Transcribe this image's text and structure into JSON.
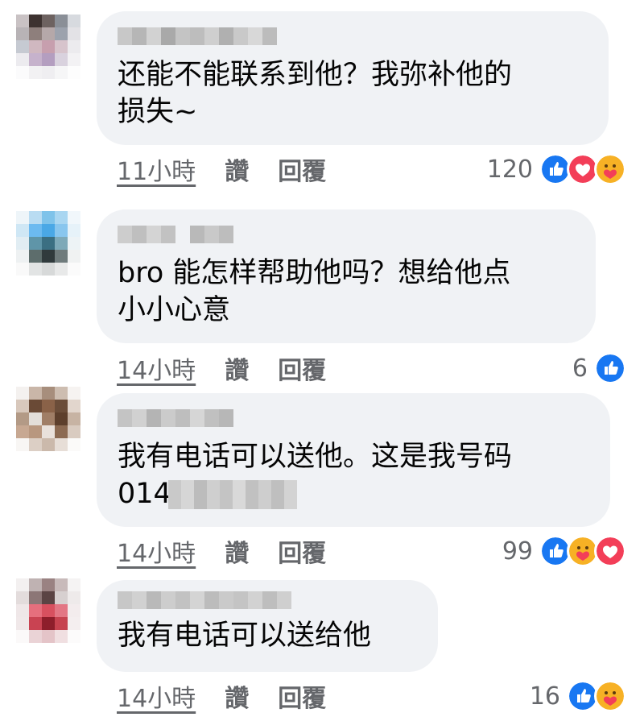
{
  "comments": [
    {
      "text": "还能不能联系到他？我弥补他的\n损失~",
      "time": "11小時",
      "like_label": "讚",
      "reply_label": "回覆",
      "reaction_count": "120",
      "reactions": [
        "like",
        "love",
        "care"
      ]
    },
    {
      "text": "bro 能怎样帮助他吗？想给他点\n小小心意",
      "time": "14小時",
      "like_label": "讚",
      "reply_label": "回覆",
      "reaction_count": "6",
      "reactions": [
        "like"
      ]
    },
    {
      "text_line1": "我有电话可以送他。这是我号码",
      "text_line2_visible": "014",
      "time": "14小時",
      "like_label": "讚",
      "reply_label": "回覆",
      "reaction_count": "99",
      "reactions": [
        "like",
        "care",
        "love"
      ]
    },
    {
      "text": "我有电话可以送给他",
      "time": "14小時",
      "like_label": "讚",
      "reply_label": "回覆",
      "reaction_count": "16",
      "reactions": [
        "like",
        "care"
      ]
    }
  ],
  "colors": {
    "bubble": "#f0f2f5",
    "meta_text": "#65676b",
    "like_blue": "#1877f2",
    "love_red": "#f33e58",
    "care_yellow": "#f7b125"
  }
}
